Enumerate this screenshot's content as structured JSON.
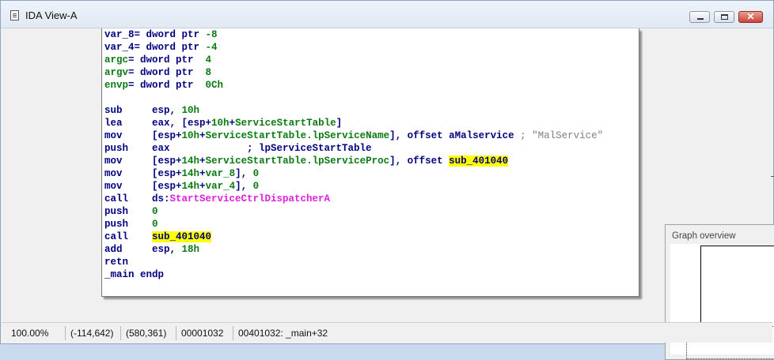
{
  "window": {
    "title": "IDA View-A"
  },
  "code_lines": [
    {
      "parts": [
        {
          "t": "var_8",
          "c": "n"
        },
        {
          "t": "= dword ptr ",
          "c": "n"
        },
        {
          "t": "-8",
          "c": "g"
        }
      ]
    },
    {
      "parts": [
        {
          "t": "var_4",
          "c": "n"
        },
        {
          "t": "= dword ptr ",
          "c": "n"
        },
        {
          "t": "-4",
          "c": "g"
        }
      ]
    },
    {
      "parts": [
        {
          "t": "argc",
          "c": "g"
        },
        {
          "t": "= dword ptr  ",
          "c": "n"
        },
        {
          "t": "4",
          "c": "g"
        }
      ]
    },
    {
      "parts": [
        {
          "t": "argv",
          "c": "g"
        },
        {
          "t": "= dword ptr  ",
          "c": "n"
        },
        {
          "t": "8",
          "c": "g"
        }
      ]
    },
    {
      "parts": [
        {
          "t": "envp",
          "c": "g"
        },
        {
          "t": "= dword ptr  ",
          "c": "n"
        },
        {
          "t": "0Ch",
          "c": "g"
        }
      ]
    },
    {
      "parts": []
    },
    {
      "parts": [
        {
          "t": "sub     esp, ",
          "c": "n"
        },
        {
          "t": "10h",
          "c": "g"
        }
      ]
    },
    {
      "parts": [
        {
          "t": "lea     eax, [esp+",
          "c": "n"
        },
        {
          "t": "10h",
          "c": "g"
        },
        {
          "t": "+",
          "c": "n"
        },
        {
          "t": "ServiceStartTable",
          "c": "g"
        },
        {
          "t": "]",
          "c": "n"
        }
      ]
    },
    {
      "parts": [
        {
          "t": "mov     [esp+",
          "c": "n"
        },
        {
          "t": "10h",
          "c": "g"
        },
        {
          "t": "+",
          "c": "n"
        },
        {
          "t": "ServiceStartTable.lpServiceName",
          "c": "g"
        },
        {
          "t": "], offset aMalservice ",
          "c": "n"
        },
        {
          "t": "; \"MalService\"",
          "c": "cmt"
        }
      ]
    },
    {
      "parts": [
        {
          "t": "push    eax             ; lpServiceStartTable",
          "c": "n"
        }
      ]
    },
    {
      "parts": [
        {
          "t": "mov     [esp+",
          "c": "n"
        },
        {
          "t": "14h",
          "c": "g"
        },
        {
          "t": "+",
          "c": "n"
        },
        {
          "t": "ServiceStartTable.lpServiceProc",
          "c": "g"
        },
        {
          "t": "], offset ",
          "c": "n"
        },
        {
          "t": "sub_401040",
          "c": "hl"
        }
      ]
    },
    {
      "parts": [
        {
          "t": "mov     [esp+",
          "c": "n"
        },
        {
          "t": "14h",
          "c": "g"
        },
        {
          "t": "+",
          "c": "n"
        },
        {
          "t": "var_8",
          "c": "g"
        },
        {
          "t": "], ",
          "c": "n"
        },
        {
          "t": "0",
          "c": "g"
        }
      ]
    },
    {
      "parts": [
        {
          "t": "mov     [esp+",
          "c": "n"
        },
        {
          "t": "14h",
          "c": "g"
        },
        {
          "t": "+",
          "c": "n"
        },
        {
          "t": "var_4",
          "c": "g"
        },
        {
          "t": "], ",
          "c": "n"
        },
        {
          "t": "0",
          "c": "g"
        }
      ]
    },
    {
      "parts": [
        {
          "t": "call    ds:",
          "c": "n"
        },
        {
          "t": "StartServiceCtrlDispatcherA",
          "c": "pink"
        }
      ]
    },
    {
      "parts": [
        {
          "t": "push    ",
          "c": "n"
        },
        {
          "t": "0",
          "c": "g"
        }
      ]
    },
    {
      "parts": [
        {
          "t": "push    ",
          "c": "n"
        },
        {
          "t": "0",
          "c": "g"
        }
      ]
    },
    {
      "parts": [
        {
          "t": "call    ",
          "c": "n"
        },
        {
          "t": "sub_401040",
          "c": "hl"
        }
      ]
    },
    {
      "parts": [
        {
          "t": "add     esp, ",
          "c": "n"
        },
        {
          "t": "18h",
          "c": "g"
        }
      ]
    },
    {
      "parts": [
        {
          "t": "retn",
          "c": "n"
        }
      ]
    },
    {
      "parts": [
        {
          "t": "_main endp",
          "c": "n"
        }
      ]
    }
  ],
  "graph_overview": {
    "title": "Graph overview"
  },
  "status": {
    "zoom": "100.00%",
    "graph_coords": "(-114,642)",
    "mouse_coords": "(580,361)",
    "offset": "00001032",
    "location": "00401032: _main+32"
  }
}
